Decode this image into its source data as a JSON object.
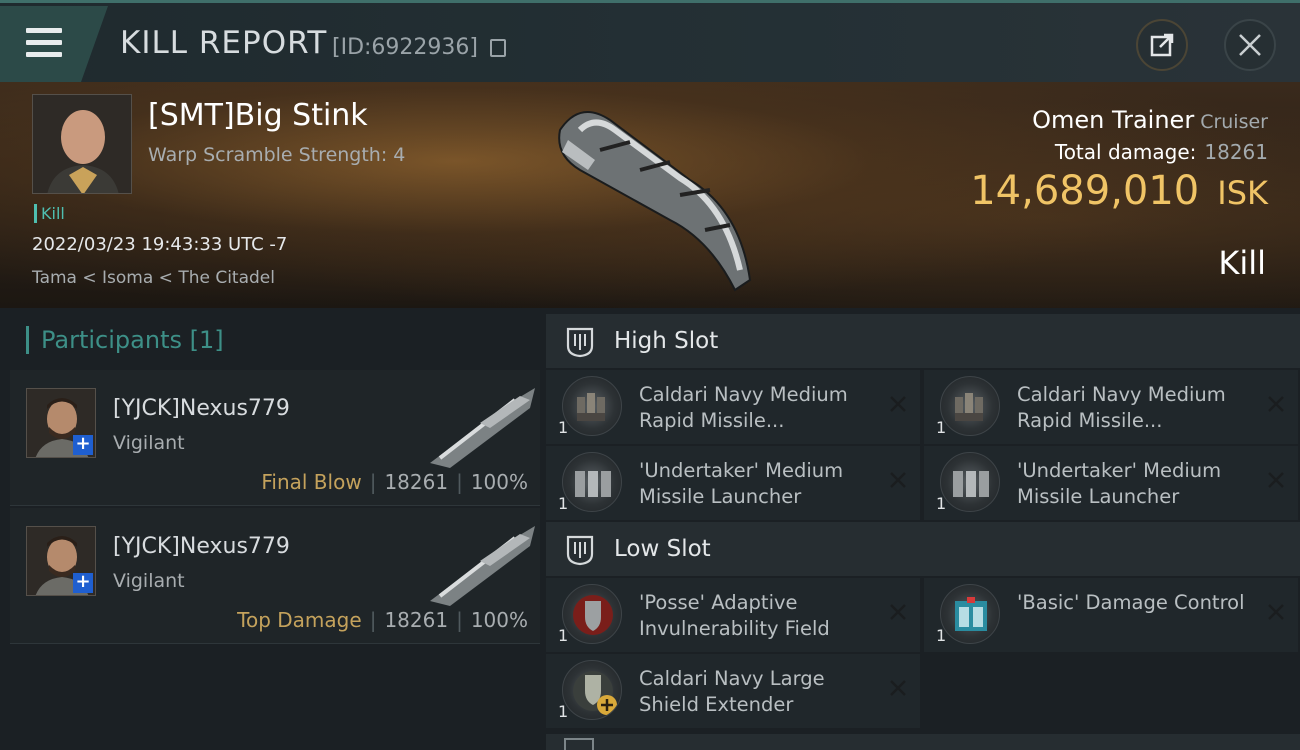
{
  "header": {
    "title": "KILL REPORT",
    "report_id": "[ID:6922936]"
  },
  "victim": {
    "name": "[SMT]Big Stink",
    "warp_scramble": "Warp Scramble Strength: 4",
    "kill_tag": "Kill",
    "datetime": "2022/03/23 19:43:33 UTC -7",
    "location": "Tama < Isoma < The Citadel",
    "ship_name": "Omen Trainer",
    "ship_class": "Cruiser",
    "total_damage_label": "Total damage:",
    "total_damage_value": "18261",
    "isk_value": "14,689,010",
    "isk_unit": "ISK",
    "result": "Kill"
  },
  "participants": {
    "label": "Participants [1]",
    "items": [
      {
        "name": "[YJCK]Nexus779",
        "ship": "Vigilant",
        "role": "Final Blow",
        "damage": "18261",
        "percent": "100%"
      },
      {
        "name": "[YJCK]Nexus779",
        "ship": "Vigilant",
        "role": "Top Damage",
        "damage": "18261",
        "percent": "100%"
      }
    ]
  },
  "slots": {
    "high": {
      "label": "High Slot",
      "modules": [
        {
          "name": "Caldari Navy Medium Rapid Missile...",
          "qty": "1"
        },
        {
          "name": "Caldari Navy Medium Rapid Missile...",
          "qty": "1"
        },
        {
          "name": "'Undertaker' Medium Missile Launcher",
          "qty": "1"
        },
        {
          "name": "'Undertaker' Medium Missile Launcher",
          "qty": "1"
        }
      ]
    },
    "low": {
      "label": "Low Slot",
      "modules": [
        {
          "name": "'Posse' Adaptive Invulnerability Field",
          "qty": "1"
        },
        {
          "name": "'Basic' Damage Control",
          "qty": "1"
        },
        {
          "name": "Caldari Navy Large Shield Extender",
          "qty": "1"
        }
      ]
    }
  },
  "colors": {
    "accent": "#3d8f87",
    "isk_gold": "#f0c466",
    "role_gold": "#c4a25c",
    "badge_blue": "#1f5fd0"
  },
  "icons": [
    "menu-icon",
    "copy-icon",
    "share-icon",
    "close-icon",
    "high-slot-icon",
    "low-slot-icon",
    "remove-icon"
  ]
}
